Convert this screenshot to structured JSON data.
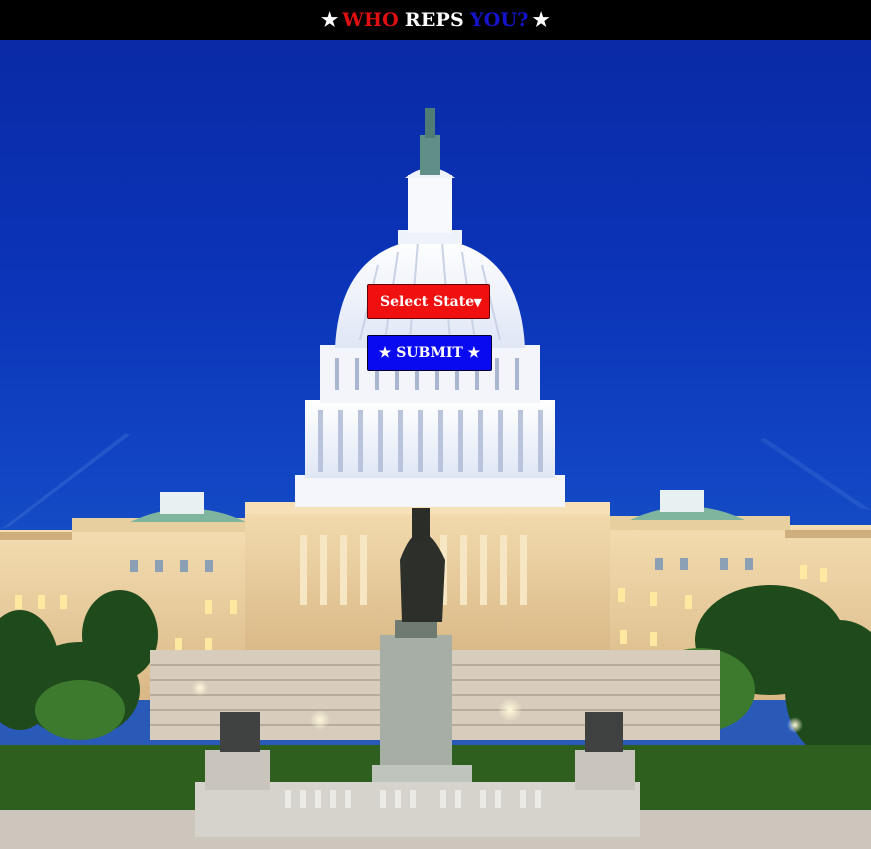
{
  "header": {
    "star_left": "★",
    "word_who": "WHO",
    "word_reps": "REPS",
    "word_you": "YOU?",
    "star_right": "★"
  },
  "form": {
    "state_select_label": "Select State",
    "state_select_arrow": "▼",
    "submit_label": "★ SUBMIT ★"
  },
  "colors": {
    "header_bg": "#000000",
    "accent_red": "#f01010",
    "accent_blue": "#0a0af0",
    "sky": "#0b34b8"
  }
}
